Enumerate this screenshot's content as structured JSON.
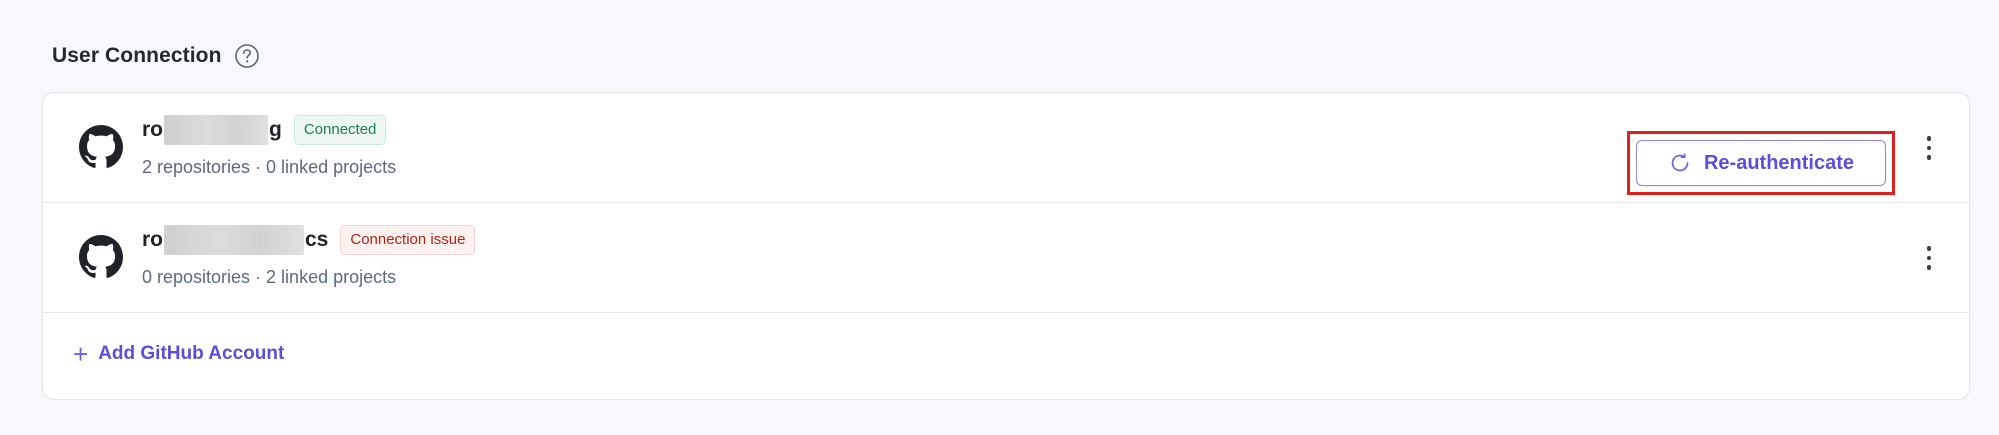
{
  "section": {
    "title": "User Connection",
    "help_icon": "question-circle-icon"
  },
  "accounts": [
    {
      "name_prefix": "ro",
      "name_suffix": "g",
      "status": "Connected",
      "meta": "2 repositories · 0 linked projects",
      "icon": "github-icon"
    },
    {
      "name_prefix": "ro",
      "name_suffix": "cs",
      "status": "Connection issue",
      "meta": "0 repositories · 2 linked projects",
      "icon": "github-icon",
      "action_label": "Re-authenticate",
      "action_icon": "refresh-icon"
    }
  ],
  "add_account": {
    "label": "Add GitHub Account",
    "icon": "plus-icon"
  },
  "colors": {
    "accent": "#5a4fdc",
    "connected": "#1a7f4b",
    "issue": "#b42318",
    "highlight": "#e0201f"
  }
}
